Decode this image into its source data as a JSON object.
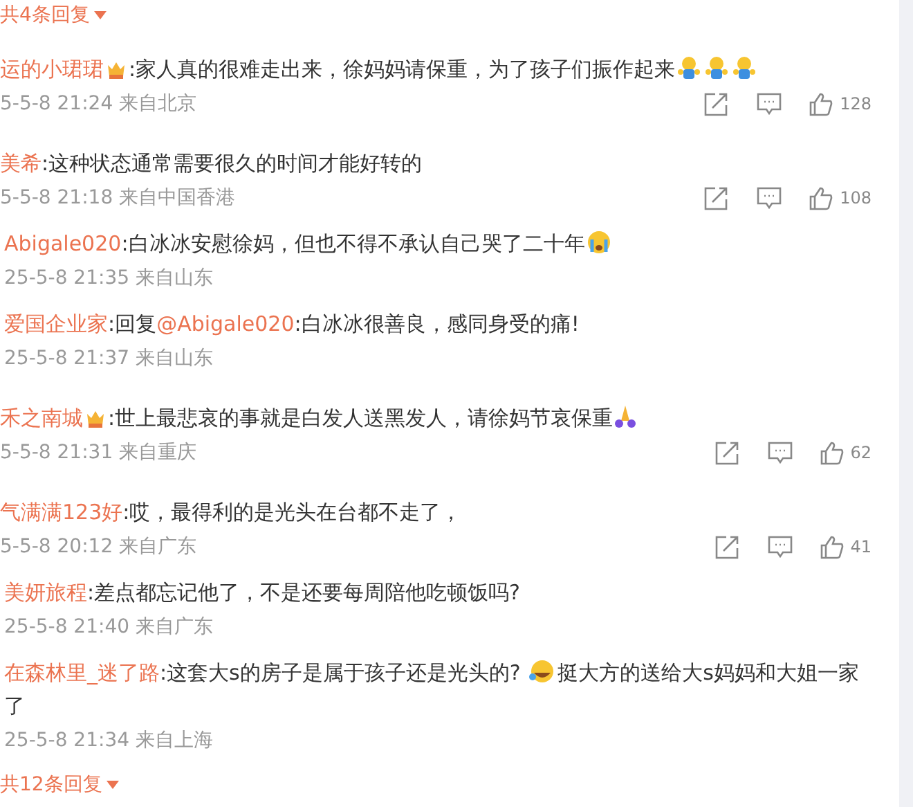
{
  "top_replies_link": {
    "text": "共4条回复"
  },
  "comments": [
    {
      "kind": "comment",
      "name": "运的小珺珺",
      "badge": true,
      "segments": [
        {
          "kind": "text",
          "text": ":家人真的很难走出来，徐妈妈请保重，为了孩子们振作起来"
        },
        {
          "kind": "hug"
        },
        {
          "kind": "hug"
        },
        {
          "kind": "hug"
        }
      ],
      "meta": "5-5-8 21:24 来自北京",
      "likes": "128"
    },
    {
      "kind": "comment",
      "name": "美希",
      "badge": false,
      "segments": [
        {
          "kind": "text",
          "text": ":这种状态通常需要很久的时间才能好转的"
        }
      ],
      "meta": "5-5-8 21:18 来自中国香港",
      "likes": "108"
    },
    {
      "kind": "reply",
      "name": "Abigale020",
      "badge": false,
      "segments": [
        {
          "kind": "text",
          "text": ":白冰冰安慰徐妈，但也不得不承认自己哭了二十年"
        },
        {
          "kind": "cry"
        }
      ],
      "meta": "25-5-8 21:35 来自山东"
    },
    {
      "kind": "reply",
      "name": "爱国企业家",
      "badge": false,
      "segments": [
        {
          "kind": "text",
          "text": ":回复"
        },
        {
          "kind": "mention",
          "text": "@Abigale020"
        },
        {
          "kind": "text",
          "text": ":白冰冰很善良，感同身受的痛!"
        }
      ],
      "meta": "25-5-8 21:37 来自山东"
    },
    {
      "kind": "comment",
      "name": "禾之南城",
      "badge": true,
      "segments": [
        {
          "kind": "text",
          "text": ":世上最悲哀的事就是白发人送黑发人，请徐妈节哀保重"
        },
        {
          "kind": "pray"
        }
      ],
      "meta": "5-5-8 21:31 来自重庆",
      "likes": "62"
    },
    {
      "kind": "comment",
      "name": "气满满123好",
      "badge": false,
      "segments": [
        {
          "kind": "text",
          "text": ":哎，最得利的是光头在台都不走了，"
        }
      ],
      "meta": "5-5-8 20:12 来自广东",
      "likes": "41"
    },
    {
      "kind": "reply",
      "name": "美妍旅程",
      "badge": false,
      "segments": [
        {
          "kind": "text",
          "text": ":差点都忘记他了，不是还要每周陪他吃顿饭吗?"
        }
      ],
      "meta": "25-5-8 21:40 来自广东"
    },
    {
      "kind": "reply",
      "name": "在森林里_迷了路",
      "badge": false,
      "segments": [
        {
          "kind": "text",
          "text": ":这套大s的房子是属于孩子还是光头的? "
        },
        {
          "kind": "laugh"
        },
        {
          "kind": "text",
          "text": "挺大方的送给大s妈妈和大姐一家了"
        }
      ],
      "meta": "25-5-8 21:34 来自上海"
    }
  ],
  "more_replies_link": {
    "text": "共12条回复"
  }
}
